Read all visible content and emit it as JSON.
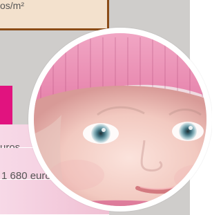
{
  "top_box": {
    "text": "os/m²"
  },
  "table": {
    "rows": [
      {
        "value": "uros"
      },
      {
        "value": "1 680 euros"
      },
      {
        "value": ""
      }
    ]
  },
  "photo": {
    "alt": "child in pink knit hat"
  },
  "colors": {
    "accent_magenta": "#e1137f",
    "brown_border": "#8a4b16",
    "panel_grey": "#cfcdcb"
  }
}
